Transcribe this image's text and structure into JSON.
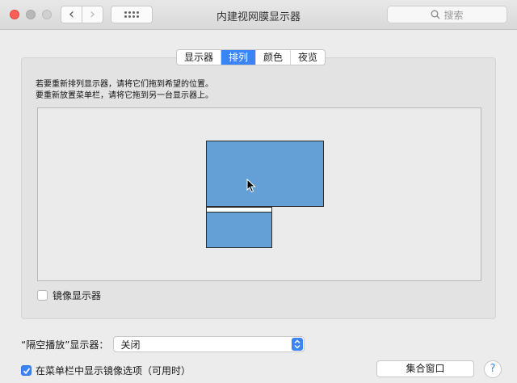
{
  "window": {
    "title": "内建视网膜显示器",
    "search_placeholder": "搜索",
    "back_glyph": "‹",
    "forward_glyph": "›"
  },
  "tabs": [
    {
      "label": "显示器",
      "active": false
    },
    {
      "label": "排列",
      "active": true
    },
    {
      "label": "颜色",
      "active": false
    },
    {
      "label": "夜览",
      "active": false
    }
  ],
  "arrangement": {
    "instruction_line1": "若要重新排列显示器，请将它们拖到希望的位置。",
    "instruction_line2": "要重新放置菜单栏，请将它拖到另一台显示器上。"
  },
  "mirror": {
    "label": "镜像显示器",
    "checked": false
  },
  "airplay": {
    "label": "“隔空播放”显示器：",
    "value": "关闭"
  },
  "menu_option": {
    "label": "在菜单栏中显示镜像选项（可用时）",
    "checked": true
  },
  "buttons": {
    "gather": "集合窗口",
    "help": "?"
  },
  "colors": {
    "accent": "#3b84f5",
    "display_fill": "#649fd6",
    "close": "#fd5f57"
  },
  "icons": {
    "search": "magnifier-icon",
    "grid": "grid-icon",
    "cursor": "arrow-cursor-icon"
  }
}
